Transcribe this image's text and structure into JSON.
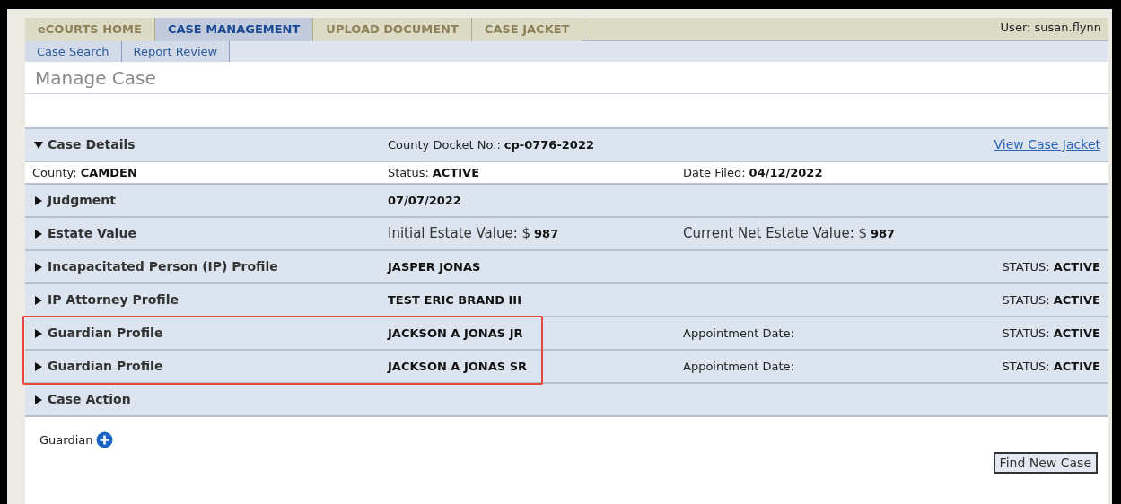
{
  "tabs": [
    {
      "label": "eCOURTS HOME",
      "selected": false
    },
    {
      "label": "CASE MANAGEMENT",
      "selected": true
    },
    {
      "label": "UPLOAD DOCUMENT",
      "selected": false
    },
    {
      "label": "CASE JACKET",
      "selected": false
    }
  ],
  "user": "User: susan.flynn",
  "subtabs": [
    "Case Search",
    "Report Review"
  ],
  "page_title": "Manage Case",
  "sections": [
    {
      "label": "Case Details",
      "expanded": true,
      "highlighted": false,
      "main": {
        "kind": "plain",
        "label": "County Docket No.:",
        "value": "cp-0776-2022"
      },
      "link": "View Case Jacket",
      "details": {
        "first": {
          "kind": "plain",
          "label": "County:",
          "value": "CAMDEN"
        },
        "main": {
          "kind": "plain",
          "label": "Status:",
          "value": "ACTIVE"
        },
        "extra": {
          "kind": "plain",
          "label": "Date Filed:",
          "value": "04/12/2022"
        }
      }
    },
    {
      "label": "Judgment",
      "expanded": false,
      "highlighted": false,
      "main": {
        "kind": "plain",
        "value": "07/07/2022"
      }
    },
    {
      "label": "Estate Value",
      "expanded": false,
      "highlighted": false,
      "main": {
        "kind": "large",
        "label": "Initial Estate Value: $",
        "value": "987"
      },
      "extra": {
        "kind": "large",
        "label": "Current Net Estate Value: $",
        "value": "987"
      }
    },
    {
      "label": "Incapacitated Person (IP) Profile",
      "expanded": false,
      "highlighted": false,
      "main": {
        "kind": "plain",
        "value": "JASPER JONAS"
      },
      "status": {
        "kind": "plain",
        "label": "STATUS:",
        "value": "ACTIVE"
      }
    },
    {
      "label": "IP Attorney Profile",
      "expanded": false,
      "highlighted": false,
      "main": {
        "kind": "plain",
        "value": "TEST ERIC BRAND III"
      },
      "status": {
        "kind": "plain",
        "label": "STATUS:",
        "value": "ACTIVE"
      }
    },
    {
      "label": "Guardian Profile",
      "expanded": false,
      "highlighted": true,
      "main": {
        "kind": "plain",
        "value": "JACKSON A JONAS JR"
      },
      "extra": {
        "kind": "plain",
        "label": "Appointment Date:"
      },
      "status": {
        "kind": "plain",
        "label": "STATUS:",
        "value": "ACTIVE"
      }
    },
    {
      "label": "Guardian Profile",
      "expanded": false,
      "highlighted": true,
      "main": {
        "kind": "plain",
        "value": "JACKSON A JONAS SR"
      },
      "extra": {
        "kind": "plain",
        "label": "Appointment Date:"
      },
      "status": {
        "kind": "plain",
        "label": "STATUS:",
        "value": "ACTIVE"
      }
    },
    {
      "label": "Case Action",
      "expanded": false,
      "highlighted": false
    }
  ],
  "add_label": "Guardian",
  "find_button": "Find New Case"
}
